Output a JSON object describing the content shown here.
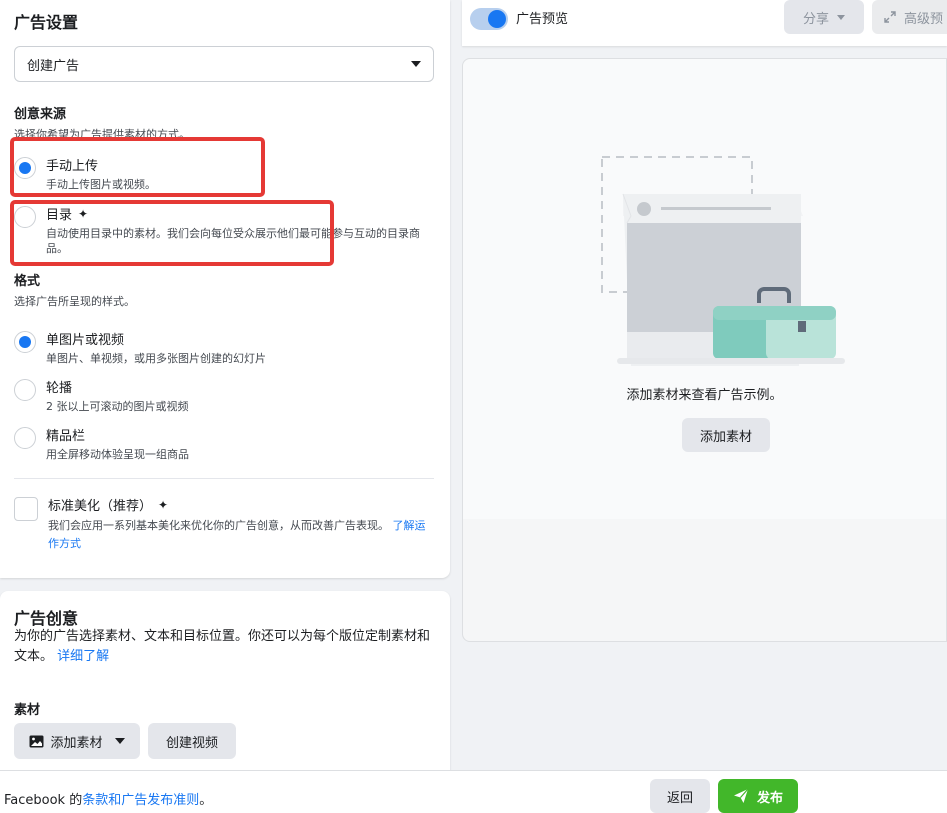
{
  "ad_settings": {
    "title": "广告设置",
    "select_value": "创建广告",
    "creative_source": {
      "heading": "创意来源",
      "subheading": "选择你希望为广告提供素材的方式。",
      "options": [
        {
          "title": "手动上传",
          "desc": "手动上传图片或视频。",
          "selected": true
        },
        {
          "title": "目录",
          "desc": "自动使用目录中的素材。我们会向每位受众展示他们最可能参与互动的目录商品。",
          "selected": false
        }
      ]
    },
    "format": {
      "heading": "格式",
      "subheading": "选择广告所呈现的样式。",
      "options": [
        {
          "title": "单图片或视频",
          "desc": "单图片、单视频，或用多张图片创建的幻灯片",
          "selected": true
        },
        {
          "title": "轮播",
          "desc": "2 张以上可滚动的图片或视频",
          "selected": false
        },
        {
          "title": "精品栏",
          "desc": "用全屏移动体验呈现一组商品",
          "selected": false
        }
      ]
    },
    "enhancement": {
      "title": "标准美化（推荐）",
      "desc": "我们会应用一系列基本美化来优化你的广告创意，从而改善广告表现。",
      "link": "了解运作方式"
    }
  },
  "ad_creative": {
    "title": "广告创意",
    "desc": "为你的广告选择素材、文本和目标位置。你还可以为每个版位定制素材和文本。",
    "link": "详细了解",
    "media_label": "素材",
    "add_media_button": "添加素材",
    "create_video_button": "创建视频"
  },
  "preview": {
    "toggle_label": "广告预览",
    "share_button": "分享",
    "advanced_button": "高级预",
    "empty_text": "添加素材来查看广告示例。",
    "add_media_button": "添加素材"
  },
  "footer": {
    "text_prefix": "Facebook 的",
    "link": "条款和广告发布准则",
    "text_suffix": "。",
    "back_button": "返回",
    "publish_button": "发布"
  },
  "colors": {
    "accent": "#1877f2",
    "publish": "#42b72a",
    "highlight": "#e53935"
  }
}
